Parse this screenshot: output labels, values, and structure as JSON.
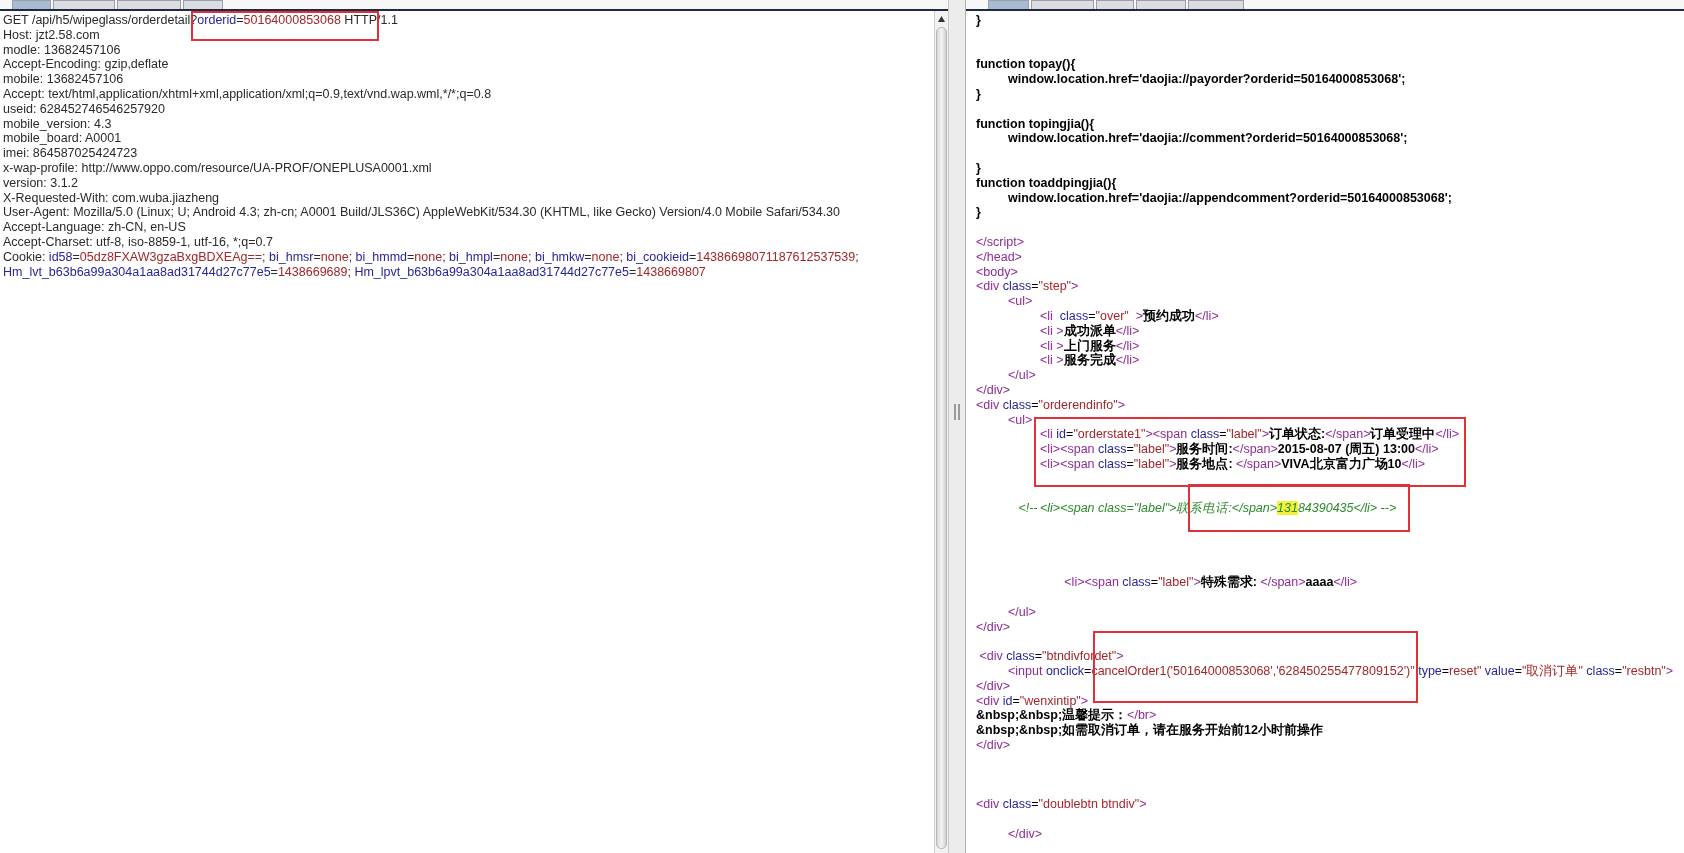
{
  "request": {
    "tabs": [
      {
        "selected": true
      },
      {
        "selected": false
      },
      {
        "selected": false
      },
      {
        "selected": false
      }
    ],
    "lines": [
      {
        "kind": "code",
        "framed": true,
        "tokens": [
          {
            "kind": "plain",
            "text": "GET /api/h5/wipeglass/orderdetail?"
          },
          {
            "kind": "attr",
            "text": "orderid"
          },
          {
            "kind": "plain",
            "text": "="
          },
          {
            "kind": "value",
            "text": "50164000853068"
          },
          {
            "kind": "plain",
            "text": " HTTP/1.1"
          }
        ]
      },
      {
        "kind": "code",
        "framed": false,
        "tokens": [
          {
            "kind": "plain",
            "text": "Host: jzt2.58.com"
          }
        ]
      },
      {
        "kind": "code",
        "framed": false,
        "tokens": [
          {
            "kind": "plain",
            "text": "modle: 13682457106"
          }
        ]
      },
      {
        "kind": "code",
        "framed": false,
        "tokens": [
          {
            "kind": "plain",
            "text": "Accept-Encoding: gzip,deflate"
          }
        ]
      },
      {
        "kind": "code",
        "framed": false,
        "tokens": [
          {
            "kind": "plain",
            "text": "mobile: 13682457106"
          }
        ]
      },
      {
        "kind": "code",
        "framed": false,
        "tokens": [
          {
            "kind": "plain",
            "text": "Accept: text/html,application/xhtml+xml,application/xml;q=0.9,text/vnd.wap.wml,*/*;q=0.8"
          }
        ]
      },
      {
        "kind": "code",
        "framed": false,
        "tokens": [
          {
            "kind": "plain",
            "text": "useid: 628452746546257920"
          }
        ]
      },
      {
        "kind": "code",
        "framed": false,
        "tokens": [
          {
            "kind": "plain",
            "text": "mobile_version: 4.3"
          }
        ]
      },
      {
        "kind": "code",
        "framed": false,
        "tokens": [
          {
            "kind": "plain",
            "text": "mobile_board: A0001"
          }
        ]
      },
      {
        "kind": "code",
        "framed": false,
        "tokens": [
          {
            "kind": "plain",
            "text": "imei: 864587025424723"
          }
        ]
      },
      {
        "kind": "code",
        "framed": false,
        "tokens": [
          {
            "kind": "plain",
            "text": "x-wap-profile: http://www.oppo.com/resource/UA-PROF/ONEPLUSA0001.xml"
          }
        ]
      },
      {
        "kind": "code",
        "framed": false,
        "tokens": [
          {
            "kind": "plain",
            "text": "version: 3.1.2"
          }
        ]
      },
      {
        "kind": "code",
        "framed": false,
        "tokens": [
          {
            "kind": "plain",
            "text": "X-Requested-With: com.wuba.jiazheng"
          }
        ]
      },
      {
        "kind": "code",
        "framed": false,
        "tokens": [
          {
            "kind": "plain",
            "text": "User-Agent: Mozilla/5.0 (Linux; U; Android 4.3; zh-cn; A0001 Build/JLS36C) AppleWebKit/534.30 (KHTML, like Gecko) Version/4.0 Mobile Safari/534.30"
          }
        ]
      },
      {
        "kind": "code",
        "framed": false,
        "tokens": [
          {
            "kind": "plain",
            "text": "Accept-Language: zh-CN, en-US"
          }
        ]
      },
      {
        "kind": "code",
        "framed": false,
        "tokens": [
          {
            "kind": "plain",
            "text": "Accept-Charset: utf-8, iso-8859-1, utf-16, *;q=0.7"
          }
        ]
      },
      {
        "kind": "code",
        "framed": false,
        "tokens": [
          {
            "kind": "plain",
            "text": "Cookie: "
          },
          {
            "kind": "attr",
            "text": "id58"
          },
          {
            "kind": "plain",
            "text": "="
          },
          {
            "kind": "value",
            "text": "05dz8FXAW3gzaBxgBDXEAg=="
          },
          {
            "kind": "plain",
            "text": "; "
          },
          {
            "kind": "attr",
            "text": "bi_hmsr"
          },
          {
            "kind": "plain",
            "text": "="
          },
          {
            "kind": "value",
            "text": "none"
          },
          {
            "kind": "plain",
            "text": "; "
          },
          {
            "kind": "attr",
            "text": "bi_hmmd"
          },
          {
            "kind": "plain",
            "text": "="
          },
          {
            "kind": "value",
            "text": "none"
          },
          {
            "kind": "plain",
            "text": "; "
          },
          {
            "kind": "attr",
            "text": "bi_hmpl"
          },
          {
            "kind": "plain",
            "text": "="
          },
          {
            "kind": "value",
            "text": "none"
          },
          {
            "kind": "plain",
            "text": "; "
          },
          {
            "kind": "attr",
            "text": "bi_hmkw"
          },
          {
            "kind": "plain",
            "text": "="
          },
          {
            "kind": "value",
            "text": "none"
          },
          {
            "kind": "plain",
            "text": "; "
          },
          {
            "kind": "attr",
            "text": "bi_cookieid"
          },
          {
            "kind": "plain",
            "text": "="
          },
          {
            "kind": "value",
            "text": "14386698071187612537539"
          },
          {
            "kind": "plain",
            "text": ";"
          }
        ]
      },
      {
        "kind": "code",
        "framed": false,
        "tokens": [
          {
            "kind": "attr",
            "text": "Hm_lvt_b63b6a99a304a1aa8ad31744d27c77e5"
          },
          {
            "kind": "plain",
            "text": "="
          },
          {
            "kind": "value",
            "text": "1438669689"
          },
          {
            "kind": "plain",
            "text": "; "
          },
          {
            "kind": "attr",
            "text": "Hm_lpvt_b63b6a99a304a1aa8ad31744d27c77e5"
          },
          {
            "kind": "plain",
            "text": "="
          },
          {
            "kind": "value",
            "text": "1438669807"
          }
        ]
      }
    ]
  },
  "response": {
    "tabs": [
      {
        "selected": true
      },
      {
        "selected": false
      },
      {
        "selected": false
      },
      {
        "selected": false
      },
      {
        "selected": false
      }
    ],
    "lines": [
      {
        "kind": "code",
        "framed": false,
        "tokens": [
          {
            "kind": "bold",
            "text": "}"
          }
        ]
      },
      {
        "kind": "blank"
      },
      {
        "kind": "blank"
      },
      {
        "kind": "code",
        "framed": false,
        "tokens": [
          {
            "kind": "bold",
            "text": "function topay(){"
          }
        ]
      },
      {
        "kind": "code",
        "framed": false,
        "tokens": [
          {
            "kind": "bold",
            "text": "\twindow.location.href='daojia://payorder?orderid=50164000853068';"
          }
        ]
      },
      {
        "kind": "code",
        "framed": false,
        "tokens": [
          {
            "kind": "bold",
            "text": "}"
          }
        ]
      },
      {
        "kind": "blank"
      },
      {
        "kind": "code",
        "framed": false,
        "tokens": [
          {
            "kind": "bold",
            "text": "function topingjia(){"
          }
        ]
      },
      {
        "kind": "code",
        "framed": false,
        "tokens": [
          {
            "kind": "bold",
            "text": "\twindow.location.href='daojia://comment?orderid=50164000853068';"
          }
        ]
      },
      {
        "kind": "blank"
      },
      {
        "kind": "code",
        "framed": false,
        "tokens": [
          {
            "kind": "bold",
            "text": "}"
          }
        ]
      },
      {
        "kind": "code",
        "framed": false,
        "tokens": [
          {
            "kind": "bold",
            "text": "function toaddpingjia(){"
          }
        ]
      },
      {
        "kind": "code",
        "framed": false,
        "tokens": [
          {
            "kind": "bold",
            "text": "\twindow.location.href='daojia://appendcomment?orderid=50164000853068';"
          }
        ]
      },
      {
        "kind": "code",
        "framed": false,
        "tokens": [
          {
            "kind": "bold",
            "text": "}"
          }
        ]
      },
      {
        "kind": "blank"
      },
      {
        "kind": "code",
        "framed": false,
        "tokens": [
          {
            "kind": "tag",
            "text": "</script>"
          }
        ]
      },
      {
        "kind": "code",
        "framed": false,
        "tokens": [
          {
            "kind": "tag",
            "text": "</head>"
          }
        ]
      },
      {
        "kind": "code",
        "framed": false,
        "tokens": [
          {
            "kind": "tag",
            "text": "<body>"
          }
        ]
      },
      {
        "kind": "code",
        "framed": false,
        "tokens": [
          {
            "kind": "tag",
            "text": "<div"
          },
          {
            "kind": "attr",
            "text": " class"
          },
          {
            "kind": "plain",
            "text": "="
          },
          {
            "kind": "value",
            "text": "\"step\""
          },
          {
            "kind": "tag",
            "text": ">"
          }
        ]
      },
      {
        "kind": "code",
        "framed": false,
        "tokens": [
          {
            "kind": "tag",
            "text": "\t<ul>"
          }
        ]
      },
      {
        "kind": "code",
        "framed": false,
        "tokens": [
          {
            "kind": "tag",
            "text": "\t\t<li"
          },
          {
            "kind": "attr",
            "text": "  class"
          },
          {
            "kind": "plain",
            "text": "="
          },
          {
            "kind": "value",
            "text": "\"over\""
          },
          {
            "kind": "tag",
            "text": "  >"
          },
          {
            "kind": "bold",
            "text": "预约成功"
          },
          {
            "kind": "tag",
            "text": "</li>"
          }
        ]
      },
      {
        "kind": "code",
        "framed": false,
        "tokens": [
          {
            "kind": "tag",
            "text": "\t\t<li >"
          },
          {
            "kind": "bold",
            "text": "成功派单"
          },
          {
            "kind": "tag",
            "text": "</li>"
          }
        ]
      },
      {
        "kind": "code",
        "framed": false,
        "tokens": [
          {
            "kind": "tag",
            "text": "\t\t<li >"
          },
          {
            "kind": "bold",
            "text": "上门服务"
          },
          {
            "kind": "tag",
            "text": "</li>"
          }
        ]
      },
      {
        "kind": "code",
        "framed": false,
        "tokens": [
          {
            "kind": "tag",
            "text": "\t\t<li >"
          },
          {
            "kind": "bold",
            "text": "服务完成"
          },
          {
            "kind": "tag",
            "text": "</li>"
          }
        ]
      },
      {
        "kind": "code",
        "framed": false,
        "tokens": [
          {
            "kind": "tag",
            "text": "\t</ul>"
          }
        ]
      },
      {
        "kind": "code",
        "framed": false,
        "tokens": [
          {
            "kind": "tag",
            "text": "</div>"
          }
        ]
      },
      {
        "kind": "code",
        "framed": false,
        "tokens": [
          {
            "kind": "tag",
            "text": "<div"
          },
          {
            "kind": "attr",
            "text": " class"
          },
          {
            "kind": "plain",
            "text": "="
          },
          {
            "kind": "value",
            "text": "\"orderendinfo\""
          },
          {
            "kind": "tag",
            "text": ">"
          }
        ]
      },
      {
        "kind": "code",
        "framed": false,
        "tokens": [
          {
            "kind": "tag",
            "text": "\t<ul>"
          }
        ]
      },
      {
        "kind": "group",
        "framed": true,
        "lines": [
          {
            "kind": "code",
            "tokens": [
              {
                "kind": "tag",
                "text": "\t\t<li"
              },
              {
                "kind": "attr",
                "text": " id"
              },
              {
                "kind": "plain",
                "text": "="
              },
              {
                "kind": "value",
                "text": "\"orderstate1\""
              },
              {
                "kind": "tag",
                "text": "><span"
              },
              {
                "kind": "attr",
                "text": " class"
              },
              {
                "kind": "plain",
                "text": "="
              },
              {
                "kind": "value",
                "text": "\"label\""
              },
              {
                "kind": "tag",
                "text": ">"
              },
              {
                "kind": "bold",
                "text": "订单状态:"
              },
              {
                "kind": "tag",
                "text": "</span>"
              },
              {
                "kind": "bold",
                "text": "订单受理中"
              },
              {
                "kind": "tag",
                "text": "</li>"
              }
            ]
          },
          {
            "kind": "code",
            "tokens": [
              {
                "kind": "tag",
                "text": "\t\t<li><span"
              },
              {
                "kind": "attr",
                "text": " class"
              },
              {
                "kind": "plain",
                "text": "="
              },
              {
                "kind": "value",
                "text": "\"label\""
              },
              {
                "kind": "tag",
                "text": ">"
              },
              {
                "kind": "bold",
                "text": "服务时间:"
              },
              {
                "kind": "tag",
                "text": "</span>"
              },
              {
                "kind": "bold",
                "text": "2015-08-07 (周五) 13:00"
              },
              {
                "kind": "tag",
                "text": "</li>"
              }
            ]
          },
          {
            "kind": "code",
            "tokens": [
              {
                "kind": "tag",
                "text": "\t\t<li><span"
              },
              {
                "kind": "attr",
                "text": " class"
              },
              {
                "kind": "plain",
                "text": "="
              },
              {
                "kind": "value",
                "text": "\"label\""
              },
              {
                "kind": "tag",
                "text": ">"
              },
              {
                "kind": "bold",
                "text": "服务地点: "
              },
              {
                "kind": "tag",
                "text": "</span>"
              },
              {
                "kind": "bold",
                "text": "VIVA北京富力广场10"
              },
              {
                "kind": "tag",
                "text": "</li>"
              }
            ]
          },
          {
            "kind": "blank"
          }
        ]
      },
      {
        "kind": "blank"
      },
      {
        "kind": "code",
        "framed": true,
        "tokens": [
          {
            "kind": "comment",
            "text": "\t   <!--\t<li><span class=\"label\">联系电话:</span>"
          },
          {
            "kind": "mark",
            "text": "131"
          },
          {
            "kind": "comment",
            "text": "84390435</li> -->"
          }
        ]
      },
      {
        "kind": "blank"
      },
      {
        "kind": "blank"
      },
      {
        "kind": "blank"
      },
      {
        "kind": "blank"
      },
      {
        "kind": "code",
        "framed": false,
        "tokens": [
          {
            "kind": "tag",
            "text": "\t\t       <li><span"
          },
          {
            "kind": "attr",
            "text": " class"
          },
          {
            "kind": "plain",
            "text": "="
          },
          {
            "kind": "value",
            "text": "\"label\""
          },
          {
            "kind": "tag",
            "text": ">"
          },
          {
            "kind": "bold",
            "text": "特殊需求: "
          },
          {
            "kind": "tag",
            "text": "</span>"
          },
          {
            "kind": "bold",
            "text": "aaaa"
          },
          {
            "kind": "tag",
            "text": "</li>"
          }
        ]
      },
      {
        "kind": "blank"
      },
      {
        "kind": "code",
        "framed": false,
        "tokens": [
          {
            "kind": "tag",
            "text": "\t</ul>"
          }
        ]
      },
      {
        "kind": "code",
        "framed": false,
        "tokens": [
          {
            "kind": "tag",
            "text": "</div>"
          }
        ]
      },
      {
        "kind": "blank"
      },
      {
        "kind": "code",
        "framed": false,
        "tokens": [
          {
            "kind": "tag",
            "text": " <div"
          },
          {
            "kind": "attr",
            "text": " class"
          },
          {
            "kind": "plain",
            "text": "="
          },
          {
            "kind": "value",
            "text": "\"btndivfordet\""
          },
          {
            "kind": "tag",
            "text": ">"
          }
        ]
      },
      {
        "kind": "code",
        "framed": true,
        "tokens": [
          {
            "kind": "tag",
            "text": "\t<input"
          },
          {
            "kind": "attr",
            "text": " onclick"
          },
          {
            "kind": "plain",
            "text": "="
          },
          {
            "kind": "value",
            "text": "cancelOrder1('50164000853068','628450255477809152')\""
          },
          {
            "kind": "attr",
            "text": " type"
          },
          {
            "kind": "plain",
            "text": "="
          },
          {
            "kind": "value",
            "text": "reset\""
          },
          {
            "kind": "attr",
            "text": " value"
          },
          {
            "kind": "plain",
            "text": "="
          },
          {
            "kind": "value",
            "text": "\"取消订单\""
          },
          {
            "kind": "attr",
            "text": " class"
          },
          {
            "kind": "plain",
            "text": "="
          },
          {
            "kind": "value",
            "text": "\"resbtn\""
          },
          {
            "kind": "tag",
            "text": ">"
          }
        ]
      },
      {
        "kind": "code",
        "framed": false,
        "tokens": [
          {
            "kind": "tag",
            "text": "</div>"
          }
        ]
      },
      {
        "kind": "code",
        "framed": false,
        "tokens": [
          {
            "kind": "tag",
            "text": "<div"
          },
          {
            "kind": "attr",
            "text": " id"
          },
          {
            "kind": "plain",
            "text": "="
          },
          {
            "kind": "value",
            "text": "\"wenxintip\""
          },
          {
            "kind": "tag",
            "text": ">"
          }
        ]
      },
      {
        "kind": "code",
        "framed": false,
        "tokens": [
          {
            "kind": "bold",
            "text": "&nbsp;&nbsp;温馨提示："
          },
          {
            "kind": "tag",
            "text": "</br>"
          }
        ]
      },
      {
        "kind": "code",
        "framed": false,
        "tokens": [
          {
            "kind": "bold",
            "text": "&nbsp;&nbsp;如需取消订单，请在服务开始前12小时前操作"
          }
        ]
      },
      {
        "kind": "code",
        "framed": false,
        "tokens": [
          {
            "kind": "tag",
            "text": "</div>"
          }
        ]
      },
      {
        "kind": "blank"
      },
      {
        "kind": "blank"
      },
      {
        "kind": "blank"
      },
      {
        "kind": "code",
        "framed": false,
        "tokens": [
          {
            "kind": "tag",
            "text": "<div"
          },
          {
            "kind": "attr",
            "text": " class"
          },
          {
            "kind": "plain",
            "text": "="
          },
          {
            "kind": "value",
            "text": "\"doublebtn btndiv\""
          },
          {
            "kind": "tag",
            "text": ">"
          }
        ]
      },
      {
        "kind": "blank"
      },
      {
        "kind": "code",
        "framed": false,
        "tokens": [
          {
            "kind": "tag",
            "text": "\t</div>"
          }
        ]
      }
    ]
  }
}
